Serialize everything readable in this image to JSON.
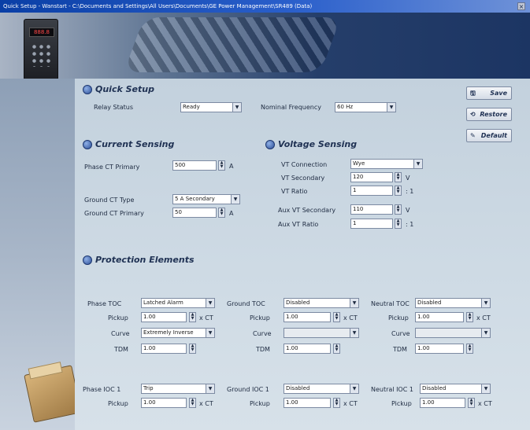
{
  "window": {
    "title": "Quick Setup - Wanstart - C:\\Documents and Settings\\All Users\\Documents\\GE Power Management\\SR489 (Data)"
  },
  "device": {
    "display": "888.8"
  },
  "buttons": {
    "save": "Save",
    "restore": "Restore",
    "default": "Default"
  },
  "quick_setup": {
    "title": "Quick Setup",
    "relay_status_label": "Relay Status",
    "relay_status_value": "Ready",
    "nominal_frequency_label": "Nominal Frequency",
    "nominal_frequency_value": "60 Hz"
  },
  "current_sensing": {
    "title": "Current Sensing",
    "phase_ct_primary_label": "Phase CT Primary",
    "phase_ct_primary_value": "500",
    "phase_ct_primary_unit": "A",
    "ground_ct_type_label": "Ground CT Type",
    "ground_ct_type_value": "5 A Secondary",
    "ground_ct_primary_label": "Ground CT Primary",
    "ground_ct_primary_value": "50",
    "ground_ct_primary_unit": "A"
  },
  "voltage_sensing": {
    "title": "Voltage Sensing",
    "vt_connection_label": "VT Connection",
    "vt_connection_value": "Wye",
    "vt_secondary_label": "VT Secondary",
    "vt_secondary_value": "120",
    "vt_secondary_unit": "V",
    "vt_ratio_label": "VT Ratio",
    "vt_ratio_value": "1",
    "vt_ratio_unit": ": 1",
    "aux_vt_secondary_label": "Aux VT Secondary",
    "aux_vt_secondary_value": "110",
    "aux_vt_secondary_unit": "V",
    "aux_vt_ratio_label": "Aux VT Ratio",
    "aux_vt_ratio_value": "1",
    "aux_vt_ratio_unit": ": 1"
  },
  "protection": {
    "title": "Protection Elements",
    "phase_toc": {
      "label": "Phase TOC",
      "value": "Latched Alarm",
      "pickup_label": "Pickup",
      "pickup_value": "1.00",
      "pickup_unit": "x CT",
      "curve_label": "Curve",
      "curve_value": "Extremely Inverse",
      "tdm_label": "TDM",
      "tdm_value": "1.00"
    },
    "ground_toc": {
      "label": "Ground TOC",
      "value": "Disabled",
      "pickup_label": "Pickup",
      "pickup_value": "1.00",
      "pickup_unit": "x CT",
      "curve_label": "Curve",
      "curve_value": "",
      "tdm_label": "TDM",
      "tdm_value": "1.00"
    },
    "neutral_toc": {
      "label": "Neutral TOC",
      "value": "Disabled",
      "pickup_label": "Pickup",
      "pickup_value": "1.00",
      "pickup_unit": "x CT",
      "curve_label": "Curve",
      "curve_value": "",
      "tdm_label": "TDM",
      "tdm_value": "1.00"
    },
    "phase_ioc1": {
      "label": "Phase IOC 1",
      "value": "Trip",
      "pickup_label": "Pickup",
      "pickup_value": "1.00",
      "pickup_unit": "x CT"
    },
    "ground_ioc1": {
      "label": "Ground IOC 1",
      "value": "Disabled",
      "pickup_label": "Pickup",
      "pickup_value": "1.00",
      "pickup_unit": "x CT"
    },
    "neutral_ioc1": {
      "label": "Neutral IOC 1",
      "value": "Disabled",
      "pickup_label": "Pickup",
      "pickup_value": "1.00",
      "pickup_unit": "x CT"
    }
  }
}
